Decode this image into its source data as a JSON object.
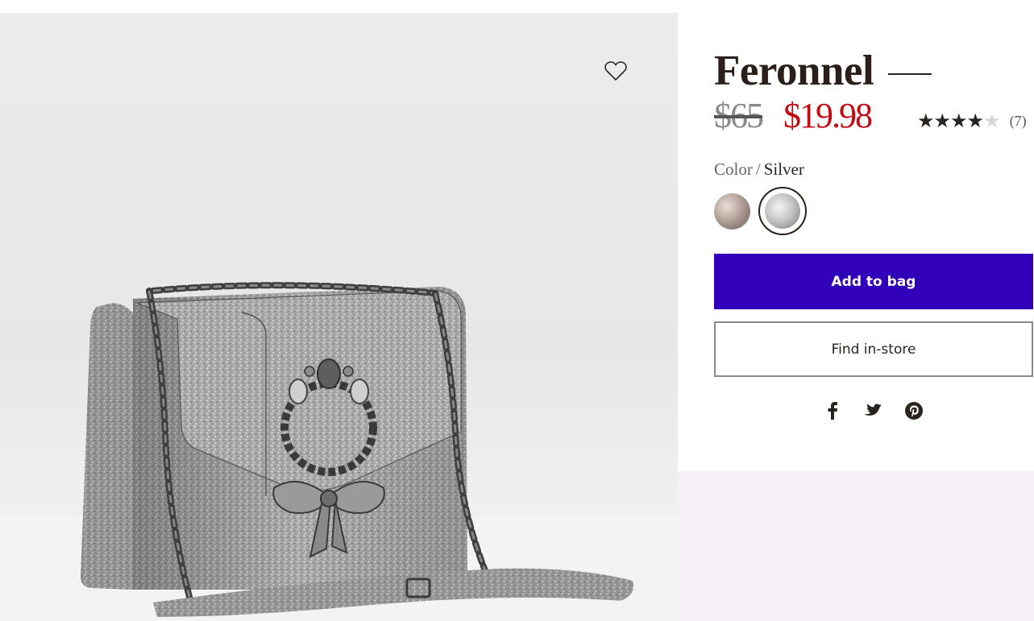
{
  "product": {
    "title": "Feronnel",
    "original_price": "$65",
    "sale_price": "$19.98",
    "rating": {
      "stars_filled": 4,
      "stars_total": 5,
      "review_count": "(7)"
    },
    "color": {
      "label": "Color",
      "separator": "/",
      "selected": "Silver"
    }
  },
  "actions": {
    "add_to_bag": "Add to bag",
    "find_in_store": "Find in-store"
  },
  "icons": {
    "wishlist": "heart-outline-icon",
    "share": [
      "facebook-icon",
      "twitter-icon",
      "pinterest-icon"
    ]
  },
  "colors": {
    "primary_button": "#3100b8",
    "sale_price": "#c20b13",
    "panel_bottom": "#f5f0f5"
  }
}
